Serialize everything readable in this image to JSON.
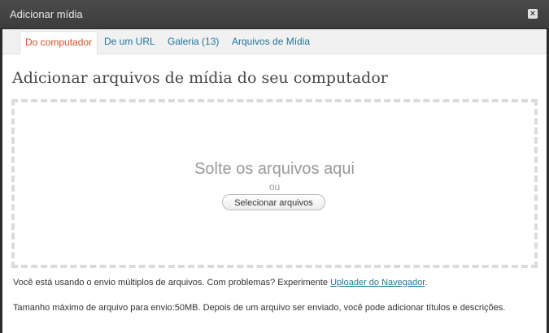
{
  "window": {
    "title": "Adicionar mídia",
    "close_icon": "close-icon",
    "close_glyph": "×"
  },
  "tabs": [
    {
      "label": "Do computador",
      "active": true
    },
    {
      "label": "De um URL",
      "active": false
    },
    {
      "label": "Galeria (13)",
      "active": false
    },
    {
      "label": "Arquivos de Mídia",
      "active": false
    }
  ],
  "main": {
    "heading": "Adicionar arquivos de mídia do seu computador",
    "dropzone": {
      "title": "Solte os arquivos aqui",
      "or": "ou",
      "select_button": "Selecionar arquivos"
    },
    "info1": {
      "text": "Você está usando o envio múltiplos de arquivos. Com problemas? Experimente ",
      "link": "Uploader do Navegador",
      "suffix": "."
    },
    "info2": "Tamanho máximo de arquivo para envio:50MB. Depois de um arquivo ser enviado, você pode adicionar títulos e descrições."
  },
  "colors": {
    "accent_link": "#21759b",
    "active_tab": "#d54e21",
    "titlebar": "#464646"
  }
}
